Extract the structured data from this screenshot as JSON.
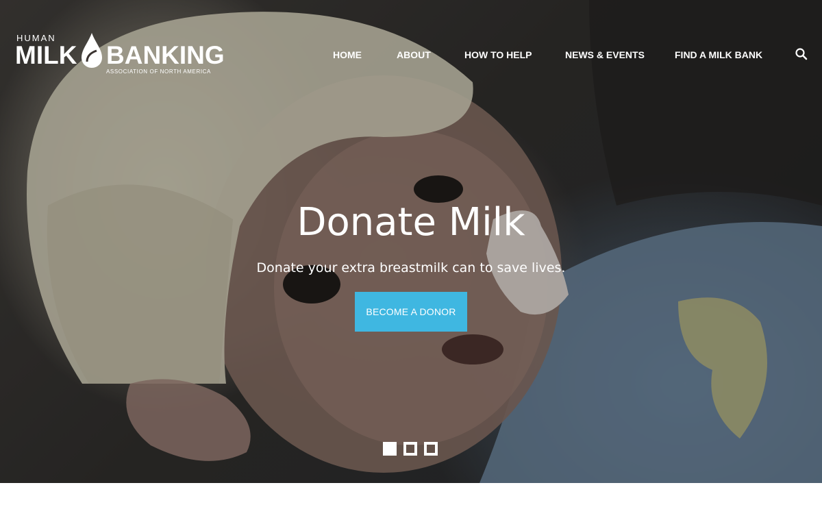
{
  "brand": {
    "line1": "HUMAN",
    "word_left": "MILK",
    "word_right": "BANKING",
    "tagline": "ASSOCIATION OF NORTH AMERICA"
  },
  "nav": {
    "items": [
      {
        "label": "HOME"
      },
      {
        "label": "ABOUT"
      },
      {
        "label": "HOW TO HELP"
      },
      {
        "label": "NEWS & EVENTS"
      },
      {
        "label": "FIND A MILK BANK"
      }
    ],
    "search_icon": "search-icon"
  },
  "hero": {
    "title": "Donate Milk",
    "subtitle": "Donate your extra breastmilk can to save lives.",
    "cta_label": "BECOME A DONOR",
    "cta_color": "#3fb7e1",
    "slides": {
      "count": 3,
      "active": 1
    }
  }
}
